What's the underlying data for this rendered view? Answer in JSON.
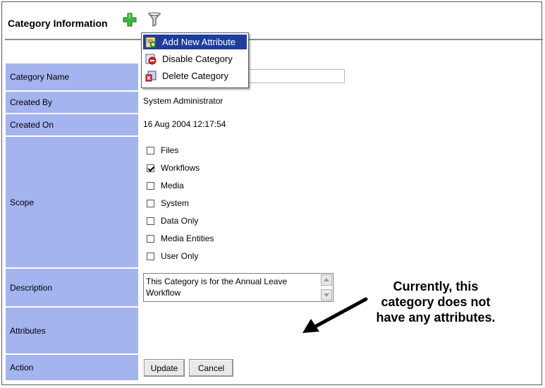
{
  "header": {
    "title": "Category Information",
    "add_icon": "plus-icon",
    "filter_icon": "funnel-icon"
  },
  "menu": {
    "items": [
      {
        "label": "Add New Attribute",
        "icon": "add-attribute-icon",
        "highlighted": true
      },
      {
        "label": "Disable Category",
        "icon": "disable-icon",
        "highlighted": false
      },
      {
        "label": "Delete Category",
        "icon": "delete-icon",
        "highlighted": false
      }
    ]
  },
  "form": {
    "labels": {
      "category_name": "Category Name",
      "created_by": "Created By",
      "created_on": "Created On",
      "scope": "Scope",
      "description": "Description",
      "attributes": "Attributes",
      "action": "Action"
    },
    "values": {
      "category_name": "",
      "created_by": "System Administrator",
      "created_on": "16 Aug 2004 12:17:54",
      "description": "This Category is for the Annual Leave Workflow"
    },
    "scope_options": [
      {
        "label": "Files",
        "checked": false
      },
      {
        "label": "Workflows",
        "checked": true
      },
      {
        "label": "Media",
        "checked": false
      },
      {
        "label": "System",
        "checked": false
      },
      {
        "label": "Data Only",
        "checked": false
      },
      {
        "label": "Media Entities",
        "checked": false
      },
      {
        "label": "User Only",
        "checked": false
      }
    ],
    "buttons": {
      "update": "Update",
      "cancel": "Cancel"
    }
  },
  "annotation": {
    "line1": "Currently, this",
    "line2": "category does not",
    "line3": "have any attributes."
  },
  "colors": {
    "label_bg": "#a3b4ef",
    "menu_highlight": "#1f3d9c"
  }
}
